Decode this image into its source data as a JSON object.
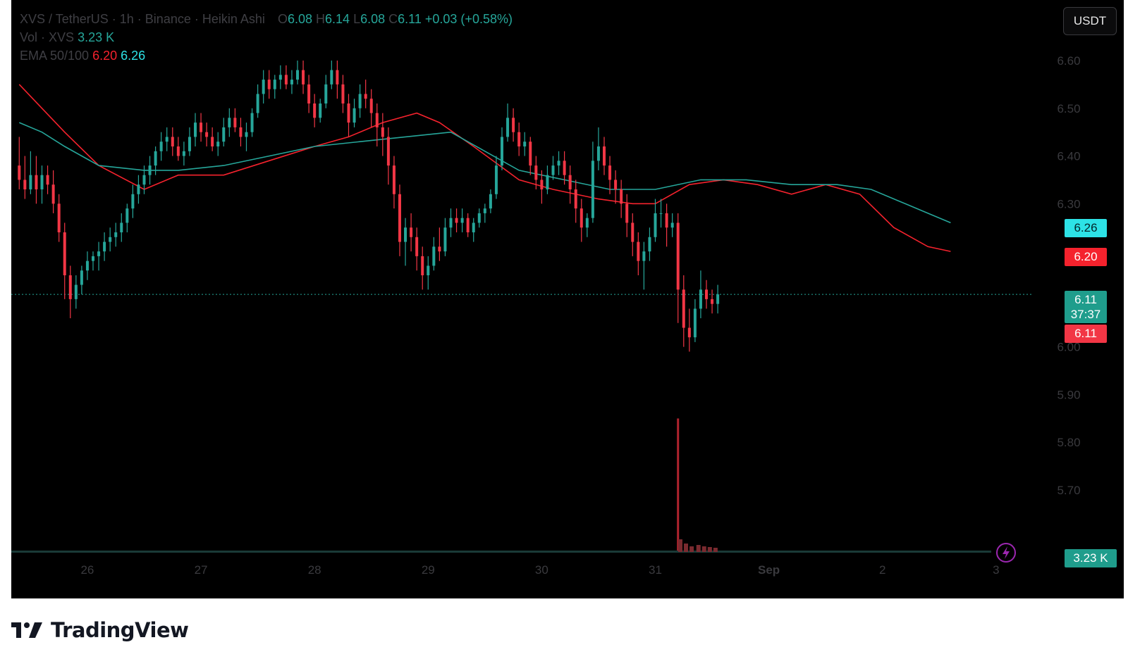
{
  "legend": {
    "symbol": "XVS / TetherUS",
    "interval": "1h",
    "exchange": "Binance",
    "style": "Heikin Ashi",
    "o_label": "O",
    "o_value": "6.08",
    "h_label": "H",
    "h_value": "6.14",
    "l_label": "L",
    "l_value": "6.08",
    "c_label": "C",
    "c_value": "6.11",
    "change": "+0.03 (+0.58%)",
    "vol_label": "Vol · XVS",
    "vol_value": "3.23 K",
    "ema_label": "EMA 50/100",
    "ema50_value": "6.20",
    "ema100_value": "6.26"
  },
  "quote_currency": "USDT",
  "price_tags": {
    "ema100": "6.26",
    "ema50": "6.20",
    "last_price": "6.11",
    "countdown": "37:37",
    "open_price": "6.11",
    "volume": "3.23 K"
  },
  "branding": {
    "logo_text": "TradingView",
    "logo_icon": "tradingview-logo-icon"
  },
  "indicator_icon": "lightning-icon",
  "colors": {
    "up": "#26a69a",
    "down": "#f23645",
    "ema50": "#f5222d",
    "ema100": "#26a69a",
    "background": "#000000",
    "price_axis_text": "#3a3a3e"
  },
  "chart_data": {
    "type": "candlestick",
    "title": "XVS / TetherUS · 1h · Binance · Heikin Ashi",
    "x_ticks": [
      "26",
      "27",
      "28",
      "29",
      "30",
      "31",
      "Sep",
      "2",
      "3"
    ],
    "y_ticks": [
      "6.60",
      "6.50",
      "6.40",
      "6.30",
      "6.00",
      "5.90",
      "5.80",
      "5.70"
    ],
    "ylim": [
      5.59,
      6.7
    ],
    "grid": false,
    "legend_position": "top-left",
    "series": [
      {
        "name": "EMA 50",
        "color": "#f5222d",
        "points": [
          [
            25.4,
            6.55
          ],
          [
            25.6,
            6.5
          ],
          [
            25.8,
            6.45
          ],
          [
            26.1,
            6.38
          ],
          [
            26.5,
            6.33
          ],
          [
            26.8,
            6.36
          ],
          [
            27.2,
            6.36
          ],
          [
            27.6,
            6.39
          ],
          [
            28.0,
            6.42
          ],
          [
            28.3,
            6.44
          ],
          [
            28.6,
            6.47
          ],
          [
            28.9,
            6.49
          ],
          [
            29.1,
            6.47
          ],
          [
            29.4,
            6.42
          ],
          [
            29.8,
            6.35
          ],
          [
            30.1,
            6.33
          ],
          [
            30.5,
            6.31
          ],
          [
            30.8,
            6.3
          ],
          [
            31.0,
            6.3
          ],
          [
            31.3,
            6.34
          ],
          [
            31.6,
            6.35
          ],
          [
            31.9,
            6.34
          ],
          [
            32.2,
            6.32
          ],
          [
            32.5,
            6.34
          ],
          [
            32.8,
            6.32
          ],
          [
            33.1,
            6.25
          ],
          [
            33.4,
            6.21
          ],
          [
            33.6,
            6.2
          ]
        ]
      },
      {
        "name": "EMA 100",
        "color": "#26a69a",
        "points": [
          [
            25.4,
            6.47
          ],
          [
            25.6,
            6.45
          ],
          [
            25.8,
            6.42
          ],
          [
            26.1,
            6.38
          ],
          [
            26.5,
            6.37
          ],
          [
            26.8,
            6.37
          ],
          [
            27.2,
            6.38
          ],
          [
            27.6,
            6.4
          ],
          [
            28.0,
            6.42
          ],
          [
            28.4,
            6.43
          ],
          [
            28.8,
            6.44
          ],
          [
            29.2,
            6.45
          ],
          [
            29.5,
            6.41
          ],
          [
            29.8,
            6.37
          ],
          [
            30.2,
            6.35
          ],
          [
            30.6,
            6.33
          ],
          [
            31.0,
            6.33
          ],
          [
            31.4,
            6.35
          ],
          [
            31.8,
            6.35
          ],
          [
            32.2,
            6.34
          ],
          [
            32.6,
            6.34
          ],
          [
            32.9,
            6.33
          ],
          [
            33.2,
            6.3
          ],
          [
            33.4,
            6.28
          ],
          [
            33.6,
            6.26
          ]
        ]
      }
    ],
    "candles_ohlc": [
      [
        25.4,
        6.38,
        6.44,
        6.33,
        6.35
      ],
      [
        25.45,
        6.35,
        6.4,
        6.31,
        6.33
      ],
      [
        25.5,
        6.33,
        6.41,
        6.32,
        6.36
      ],
      [
        25.55,
        6.36,
        6.4,
        6.3,
        6.33
      ],
      [
        25.6,
        6.33,
        6.38,
        6.3,
        6.36
      ],
      [
        25.65,
        6.36,
        6.38,
        6.32,
        6.34
      ],
      [
        25.7,
        6.34,
        6.37,
        6.28,
        6.3
      ],
      [
        25.75,
        6.3,
        6.32,
        6.22,
        6.24
      ],
      [
        25.8,
        6.24,
        6.26,
        6.1,
        6.15
      ],
      [
        25.85,
        6.15,
        6.17,
        6.06,
        6.1
      ],
      [
        25.9,
        6.1,
        6.15,
        6.08,
        6.13
      ],
      [
        25.95,
        6.13,
        6.17,
        6.11,
        6.16
      ],
      [
        26.0,
        6.16,
        6.2,
        6.14,
        6.18
      ],
      [
        26.05,
        6.18,
        6.2,
        6.16,
        6.19
      ],
      [
        26.1,
        6.19,
        6.22,
        6.16,
        6.2
      ],
      [
        26.15,
        6.2,
        6.24,
        6.18,
        6.22
      ],
      [
        26.2,
        6.22,
        6.25,
        6.2,
        6.23
      ],
      [
        26.25,
        6.23,
        6.26,
        6.21,
        6.24
      ],
      [
        26.3,
        6.24,
        6.28,
        6.22,
        6.26
      ],
      [
        26.35,
        6.26,
        6.3,
        6.24,
        6.29
      ],
      [
        26.4,
        6.29,
        6.34,
        6.27,
        6.32
      ],
      [
        26.45,
        6.32,
        6.36,
        6.3,
        6.34
      ],
      [
        26.5,
        6.34,
        6.38,
        6.32,
        6.36
      ],
      [
        26.55,
        6.36,
        6.4,
        6.34,
        6.38
      ],
      [
        26.6,
        6.38,
        6.42,
        6.36,
        6.41
      ],
      [
        26.65,
        6.41,
        6.45,
        6.39,
        6.43
      ],
      [
        26.7,
        6.43,
        6.46,
        6.41,
        6.44
      ],
      [
        26.75,
        6.44,
        6.46,
        6.4,
        6.42
      ],
      [
        26.8,
        6.42,
        6.44,
        6.39,
        6.4
      ],
      [
        26.85,
        6.4,
        6.43,
        6.38,
        6.41
      ],
      [
        26.9,
        6.41,
        6.46,
        6.4,
        6.44
      ],
      [
        26.95,
        6.44,
        6.49,
        6.42,
        6.47
      ],
      [
        27.0,
        6.47,
        6.49,
        6.43,
        6.45
      ],
      [
        27.05,
        6.45,
        6.47,
        6.42,
        6.44
      ],
      [
        27.1,
        6.44,
        6.46,
        6.41,
        6.42
      ],
      [
        27.15,
        6.42,
        6.45,
        6.4,
        6.43
      ],
      [
        27.2,
        6.43,
        6.48,
        6.42,
        6.46
      ],
      [
        27.25,
        6.46,
        6.5,
        6.44,
        6.48
      ],
      [
        27.3,
        6.48,
        6.5,
        6.45,
        6.46
      ],
      [
        27.35,
        6.46,
        6.48,
        6.42,
        6.44
      ],
      [
        27.4,
        6.44,
        6.47,
        6.41,
        6.45
      ],
      [
        27.45,
        6.45,
        6.5,
        6.44,
        6.49
      ],
      [
        27.5,
        6.49,
        6.55,
        6.48,
        6.53
      ],
      [
        27.55,
        6.53,
        6.58,
        6.51,
        6.56
      ],
      [
        27.6,
        6.56,
        6.58,
        6.52,
        6.54
      ],
      [
        27.65,
        6.54,
        6.57,
        6.52,
        6.56
      ],
      [
        27.7,
        6.56,
        6.59,
        6.54,
        6.57
      ],
      [
        27.75,
        6.57,
        6.59,
        6.54,
        6.55
      ],
      [
        27.8,
        6.55,
        6.58,
        6.53,
        6.56
      ],
      [
        27.85,
        6.56,
        6.6,
        6.55,
        6.58
      ],
      [
        27.9,
        6.58,
        6.6,
        6.53,
        6.55
      ],
      [
        27.95,
        6.55,
        6.57,
        6.49,
        6.51
      ],
      [
        28.0,
        6.51,
        6.53,
        6.46,
        6.48
      ],
      [
        28.05,
        6.48,
        6.52,
        6.47,
        6.51
      ],
      [
        28.1,
        6.51,
        6.57,
        6.5,
        6.55
      ],
      [
        28.15,
        6.55,
        6.6,
        6.54,
        6.58
      ],
      [
        28.2,
        6.58,
        6.6,
        6.52,
        6.55
      ],
      [
        28.25,
        6.55,
        6.57,
        6.49,
        6.51
      ],
      [
        28.3,
        6.51,
        6.53,
        6.44,
        6.47
      ],
      [
        28.35,
        6.47,
        6.52,
        6.46,
        6.5
      ],
      [
        28.4,
        6.5,
        6.55,
        6.48,
        6.53
      ],
      [
        28.45,
        6.53,
        6.56,
        6.5,
        6.52
      ],
      [
        28.5,
        6.52,
        6.54,
        6.46,
        6.49
      ],
      [
        28.55,
        6.49,
        6.51,
        6.42,
        6.46
      ],
      [
        28.6,
        6.46,
        6.49,
        6.4,
        6.44
      ],
      [
        28.65,
        6.44,
        6.46,
        6.34,
        6.38
      ],
      [
        28.7,
        6.38,
        6.4,
        6.29,
        6.32
      ],
      [
        28.75,
        6.32,
        6.34,
        6.19,
        6.22
      ],
      [
        28.8,
        6.22,
        6.27,
        6.17,
        6.25
      ],
      [
        28.85,
        6.25,
        6.28,
        6.2,
        6.23
      ],
      [
        28.9,
        6.23,
        6.25,
        6.16,
        6.19
      ],
      [
        28.95,
        6.19,
        6.21,
        6.12,
        6.15
      ],
      [
        29.0,
        6.15,
        6.19,
        6.12,
        6.17
      ],
      [
        29.05,
        6.17,
        6.23,
        6.16,
        6.21
      ],
      [
        29.1,
        6.21,
        6.25,
        6.18,
        6.2
      ],
      [
        29.15,
        6.2,
        6.27,
        6.19,
        6.25
      ],
      [
        29.2,
        6.25,
        6.29,
        6.23,
        6.27
      ],
      [
        29.25,
        6.27,
        6.29,
        6.24,
        6.26
      ],
      [
        29.3,
        6.26,
        6.29,
        6.24,
        6.27
      ],
      [
        29.35,
        6.27,
        6.28,
        6.23,
        6.24
      ],
      [
        29.4,
        6.24,
        6.27,
        6.22,
        6.26
      ],
      [
        29.45,
        6.26,
        6.29,
        6.25,
        6.28
      ],
      [
        29.5,
        6.28,
        6.3,
        6.26,
        6.29
      ],
      [
        29.55,
        6.29,
        6.33,
        6.28,
        6.32
      ],
      [
        29.6,
        6.32,
        6.4,
        6.31,
        6.38
      ],
      [
        29.65,
        6.38,
        6.46,
        6.37,
        6.44
      ],
      [
        29.7,
        6.44,
        6.51,
        6.43,
        6.48
      ],
      [
        29.75,
        6.48,
        6.5,
        6.43,
        6.45
      ],
      [
        29.8,
        6.45,
        6.47,
        6.4,
        6.42
      ],
      [
        29.85,
        6.42,
        6.45,
        6.4,
        6.43
      ],
      [
        29.9,
        6.43,
        6.44,
        6.36,
        6.38
      ],
      [
        29.95,
        6.38,
        6.4,
        6.33,
        6.35
      ],
      [
        30.0,
        6.35,
        6.37,
        6.3,
        6.33
      ],
      [
        30.05,
        6.33,
        6.38,
        6.32,
        6.36
      ],
      [
        30.1,
        6.36,
        6.4,
        6.35,
        6.38
      ],
      [
        30.15,
        6.38,
        6.41,
        6.36,
        6.39
      ],
      [
        30.2,
        6.39,
        6.41,
        6.34,
        6.36
      ],
      [
        30.25,
        6.36,
        6.38,
        6.3,
        6.33
      ],
      [
        30.3,
        6.33,
        6.35,
        6.26,
        6.29
      ],
      [
        30.35,
        6.29,
        6.31,
        6.22,
        6.25
      ],
      [
        30.4,
        6.25,
        6.28,
        6.23,
        6.27
      ],
      [
        30.45,
        6.27,
        6.43,
        6.26,
        6.39
      ],
      [
        30.5,
        6.39,
        6.46,
        6.37,
        6.42
      ],
      [
        30.55,
        6.42,
        6.44,
        6.36,
        6.38
      ],
      [
        30.6,
        6.38,
        6.4,
        6.32,
        6.35
      ],
      [
        30.65,
        6.35,
        6.37,
        6.3,
        6.33
      ],
      [
        30.7,
        6.33,
        6.35,
        6.27,
        6.3
      ],
      [
        30.75,
        6.3,
        6.32,
        6.23,
        6.26
      ],
      [
        30.8,
        6.26,
        6.28,
        6.19,
        6.22
      ],
      [
        30.85,
        6.22,
        6.24,
        6.15,
        6.18
      ],
      [
        30.9,
        6.18,
        6.22,
        6.12,
        6.2
      ],
      [
        30.95,
        6.2,
        6.25,
        6.18,
        6.23
      ],
      [
        31.0,
        6.23,
        6.31,
        6.22,
        6.28
      ],
      [
        31.05,
        6.28,
        6.31,
        6.25,
        6.28
      ],
      [
        31.1,
        6.28,
        6.3,
        6.21,
        6.25
      ],
      [
        31.15,
        6.25,
        6.28,
        6.23,
        6.26
      ],
      [
        31.2,
        6.26,
        6.28,
        6.05,
        6.12
      ],
      [
        31.25,
        6.12,
        6.15,
        6.0,
        6.04
      ],
      [
        31.3,
        6.04,
        6.08,
        5.99,
        6.02
      ],
      [
        31.35,
        6.02,
        6.1,
        6.01,
        6.08
      ],
      [
        31.4,
        6.08,
        6.16,
        6.06,
        6.12
      ],
      [
        31.45,
        6.12,
        6.14,
        6.08,
        6.1
      ],
      [
        31.5,
        6.1,
        6.12,
        6.07,
        6.09
      ],
      [
        31.55,
        6.09,
        6.13,
        6.07,
        6.11
      ]
    ]
  }
}
